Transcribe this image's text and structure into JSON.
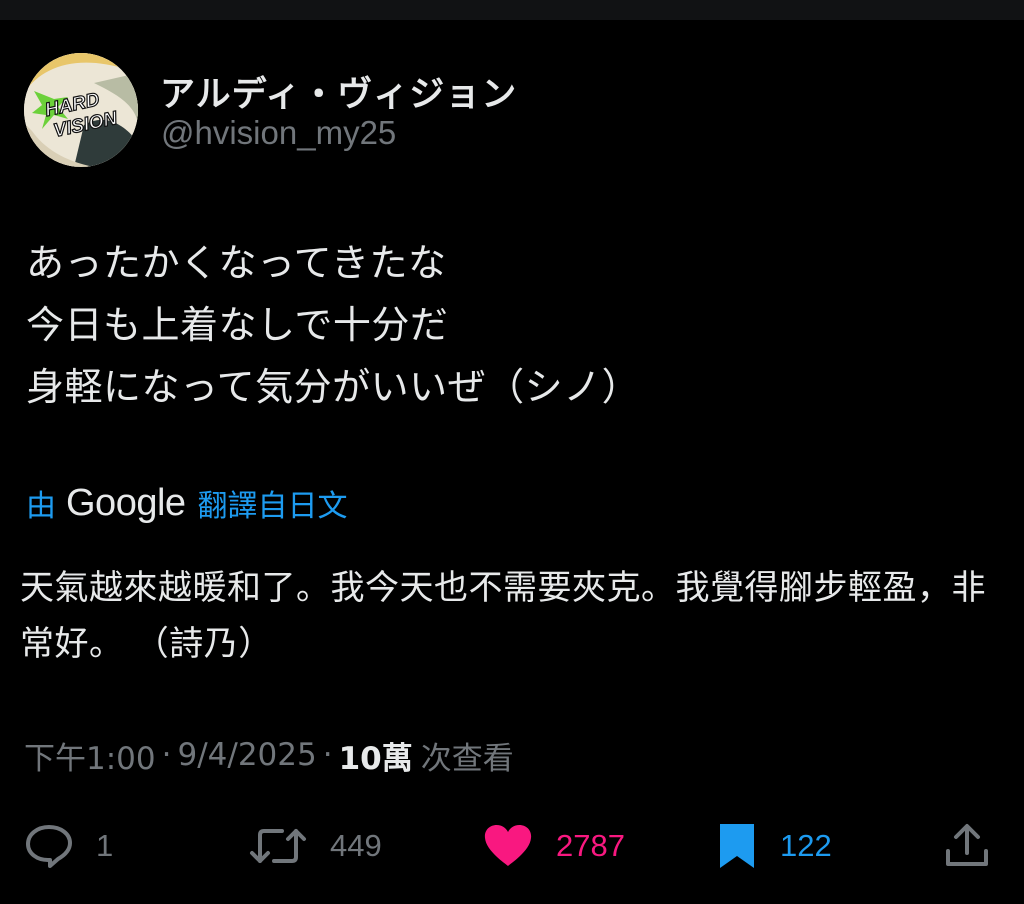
{
  "author": {
    "display_name": "アルディ・ヴィジョン",
    "handle": "@hvision_my25",
    "avatar_text": "HARD VISION"
  },
  "tweet": {
    "lines": [
      "あったかくなってきたな",
      "今日も上着なしで十分だ",
      "身軽になって気分がいいぜ（シノ）"
    ]
  },
  "translation": {
    "by_label": "由",
    "provider": "Google",
    "from_label": "翻譯自日文",
    "text": "天氣越來越暖和了。我今天也不需要夾克。我覺得腳步輕盈，非常好。 （詩乃）"
  },
  "meta": {
    "time": "下午1:00",
    "separator": "·",
    "date": "9/4/2025",
    "views_count": "10萬",
    "views_label": "次查看"
  },
  "actions": {
    "reply": {
      "icon": "reply-icon",
      "count": "1"
    },
    "retweet": {
      "icon": "retweet-icon",
      "count": "449"
    },
    "like": {
      "icon": "heart-icon",
      "count": "2787",
      "color": "#f91880"
    },
    "bookmark": {
      "icon": "bookmark-icon",
      "count": "122",
      "color": "#1d9bf0"
    },
    "share": {
      "icon": "share-icon"
    }
  },
  "colors": {
    "background": "#000000",
    "text": "#e7e9ea",
    "muted": "#71767b",
    "accent": "#1d9bf0"
  }
}
